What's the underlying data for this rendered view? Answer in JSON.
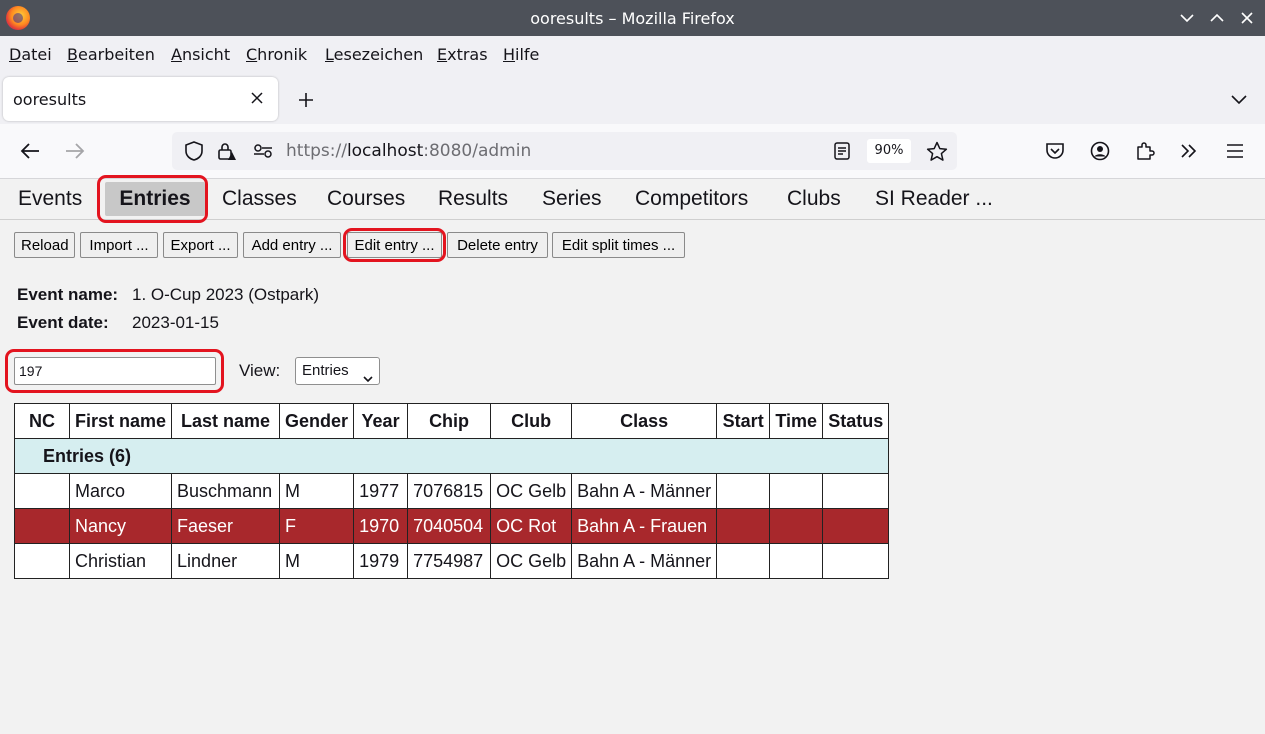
{
  "window": {
    "title": "ooresults – Mozilla Firefox"
  },
  "menu": [
    "Datei",
    "Bearbeiten",
    "Ansicht",
    "Chronik",
    "Lesezeichen",
    "Extras",
    "Hilfe"
  ],
  "menu_accel": [
    "D",
    "B",
    "A",
    "C",
    "L",
    "E",
    "H"
  ],
  "tab": {
    "title": "ooresults"
  },
  "url": {
    "scheme": "https://",
    "host": "localhost",
    "rest": ":8080/admin"
  },
  "zoom": "90%",
  "app_tabs": [
    "Events",
    "Entries",
    "Classes",
    "Courses",
    "Results",
    "Series",
    "Competitors",
    "Clubs",
    "SI Reader ..."
  ],
  "active_tab": "Entries",
  "toolbar": [
    "Reload",
    "Import ...",
    "Export ...",
    "Add entry ...",
    "Edit entry ...",
    "Delete entry",
    "Edit split times ..."
  ],
  "event": {
    "name_label": "Event name:",
    "name": "1. O-Cup 2023 (Ostpark)",
    "date_label": "Event date:",
    "date": "2023-01-15"
  },
  "search": {
    "value": "197"
  },
  "view": {
    "label": "View:",
    "selected": "Entries"
  },
  "table": {
    "columns": [
      "NC",
      "First name",
      "Last name",
      "Gender",
      "Year",
      "Chip",
      "Club",
      "Class",
      "Start",
      "Time",
      "Status"
    ],
    "group": "Entries  (6)",
    "rows": [
      [
        "",
        "Marco",
        "Buschmann",
        "M",
        "1977",
        "7076815",
        "OC Gelb",
        "Bahn A - Männer",
        "",
        "",
        ""
      ],
      [
        "",
        "Nancy",
        "Faeser",
        "F",
        "1970",
        "7040504",
        "OC Rot",
        "Bahn A - Frauen",
        "",
        "",
        ""
      ],
      [
        "",
        "Christian",
        "Lindner",
        "M",
        "1979",
        "7754987",
        "OC Gelb",
        "Bahn A - Männer",
        "",
        "",
        ""
      ]
    ],
    "selected_row": 1
  },
  "colors": {
    "highlight": "#e3141f",
    "selected_row": "#a8282c",
    "group_row": "#d6eef0"
  }
}
